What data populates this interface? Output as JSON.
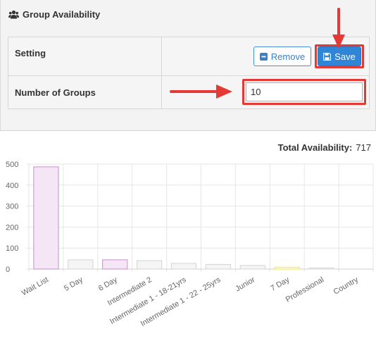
{
  "panel": {
    "title": "Group Availability",
    "icon": "users-icon"
  },
  "settings": {
    "setting_label": "Setting",
    "remove_label": "Remove",
    "save_label": "Save",
    "groups_label": "Number of Groups",
    "groups_value": "10"
  },
  "total": {
    "label": "Total Availability:",
    "value": "717"
  },
  "colors": {
    "highlight": "#e53935",
    "save_button": "#2f86d8",
    "remove_border": "#4a90d9"
  },
  "chart_data": {
    "type": "bar",
    "categories": [
      "Wait List",
      "5 Day",
      "6 Day",
      "Intermediate 2",
      "Intermediate 1 - 18-21yrs",
      "Intermediate 1 - 22 - 25yrs",
      "Junior",
      "7 Day",
      "Professional",
      "Country"
    ],
    "values": [
      487,
      44,
      44,
      40,
      27,
      22,
      17,
      9,
      5,
      0
    ],
    "bar_colors": [
      "#f4e6f4",
      "#f5f5f5",
      "#f4e6f4",
      "#f5f5f5",
      "#f5f5f5",
      "#f5f5f5",
      "#f5f5f5",
      "#fcfce0",
      "#f5f5f5",
      "#f5f5f5"
    ],
    "border_colors": [
      "#c98cd0",
      "#d4d4d4",
      "#c98cd0",
      "#d4d4d4",
      "#d4d4d4",
      "#d4d4d4",
      "#d4d4d4",
      "#f2ea3c",
      "#d4d4d4",
      "#d4d4d4"
    ],
    "yticks": [
      0,
      100,
      200,
      300,
      400,
      500
    ],
    "ylim": [
      0,
      500
    ],
    "grid": true,
    "title": "",
    "xlabel": "",
    "ylabel": ""
  }
}
